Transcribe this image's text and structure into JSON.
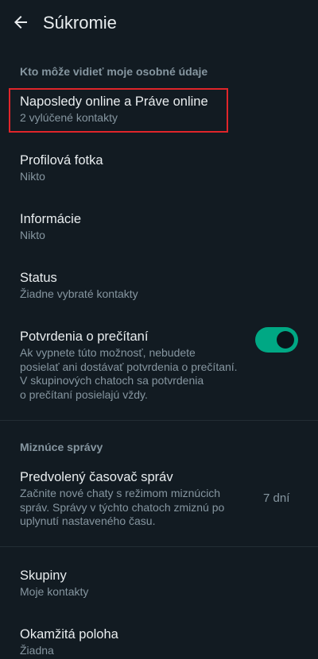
{
  "header": {
    "title": "Súkromie",
    "back_icon": "arrow-left-icon"
  },
  "sections": [
    {
      "header": "Kto môže vidieť moje osobné údaje",
      "items": [
        {
          "title": "Naposledy online a Práve online",
          "subtitle": "2 vylúčené kontakty"
        },
        {
          "title": "Profilová fotka",
          "subtitle": "Nikto"
        },
        {
          "title": "Informácie",
          "subtitle": "Nikto"
        },
        {
          "title": "Status",
          "subtitle": "Žiadne vybraté kontakty"
        },
        {
          "title": "Potvrdenia o prečítaní",
          "subtitle_lines": [
            "Ak vypnete túto možnosť, nebudete",
            "posielať ani dostávať potvrdenia o prečítaní.",
            "V skupinových chatoch sa potvrdenia",
            "o prečítaní posielajú vždy."
          ],
          "toggle_on": true
        }
      ]
    },
    {
      "header": "Miznúce správy",
      "items": [
        {
          "title": "Predvolený časovač správ",
          "subtitle_lines": [
            "Začnite nové chaty s režimom miznúcich",
            "správ. Správy v týchto chatoch zmiznú po",
            "uplynutí nastaveného času."
          ],
          "value": "7 dní"
        }
      ]
    },
    {
      "items": [
        {
          "title": "Skupiny",
          "subtitle": "Moje kontakty"
        },
        {
          "title": "Okamžitá poloha",
          "subtitle": "Žiadna"
        }
      ]
    }
  ],
  "colors": {
    "background": "#121b22",
    "accent": "#00a884",
    "primary_text": "#e9edef",
    "secondary_text": "#8696a0",
    "highlight": "#e0252a"
  }
}
